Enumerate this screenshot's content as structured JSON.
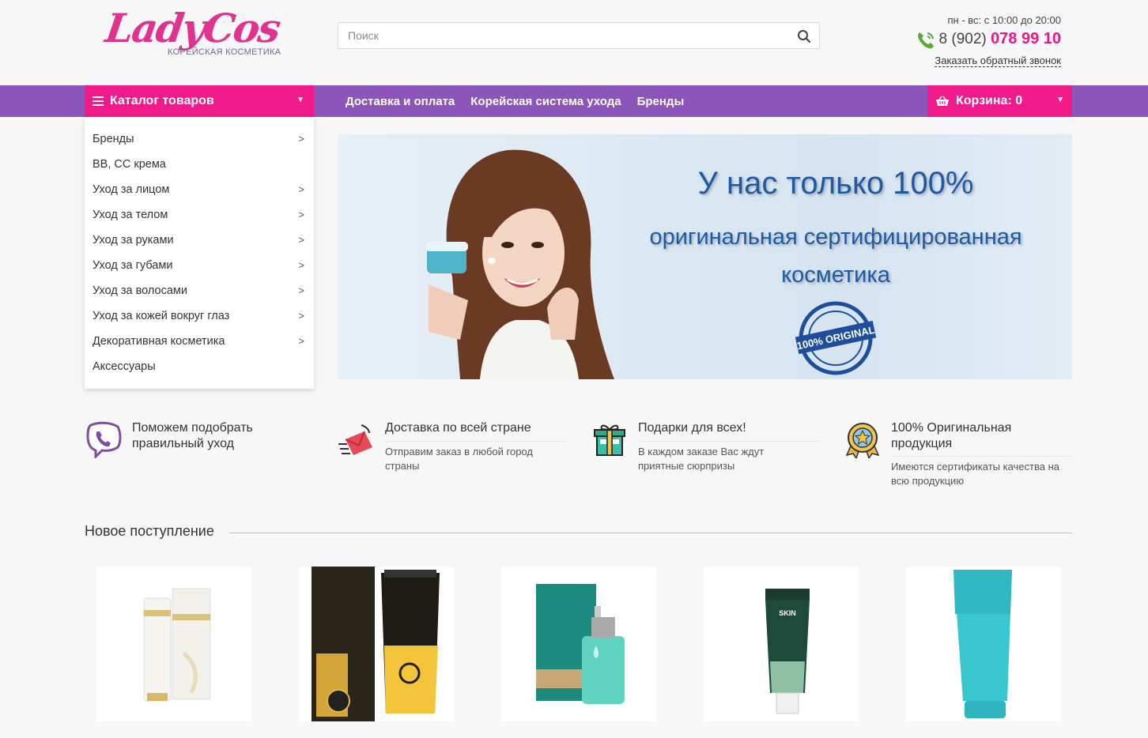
{
  "header": {
    "logo_text": "LadyCos",
    "logo_sub": "КОРЕЙСКАЯ КОСМЕТИКА",
    "search_placeholder": "Поиск",
    "hours": "пн - вс: с 10:00 до 20:00",
    "phone_prefix": "8 (902)",
    "phone_number": "078 99 10",
    "callback": "Заказать обратный звонок"
  },
  "nav": {
    "catalog": "Каталог товаров",
    "links": [
      "Доставка и оплата",
      "Корейская система ухода",
      "Бренды"
    ],
    "cart": "Корзина: 0"
  },
  "menu": [
    {
      "label": "Бренды",
      "has_sub": true
    },
    {
      "label": "BB, CC крема",
      "has_sub": false
    },
    {
      "label": "Уход за лицом",
      "has_sub": true
    },
    {
      "label": "Уход за телом",
      "has_sub": true
    },
    {
      "label": "Уход за руками",
      "has_sub": true
    },
    {
      "label": "Уход за губами",
      "has_sub": true
    },
    {
      "label": "Уход за волосами",
      "has_sub": true
    },
    {
      "label": "Уход за кожей вокруг глаз",
      "has_sub": true
    },
    {
      "label": "Декоративная косметика",
      "has_sub": true
    },
    {
      "label": "Аксессуары",
      "has_sub": false
    }
  ],
  "banner": {
    "line1": "У нас только 100%",
    "line2": "оригинальная сертифицированная",
    "line3": "косметика",
    "badge_text": "100% ORIGINAL"
  },
  "features": [
    {
      "icon": "viber-icon",
      "title": "Поможем подобрать правильный уход",
      "desc": ""
    },
    {
      "icon": "delivery-icon",
      "title": "Доставка по всей стране",
      "desc": "Отправим заказ в любой город страны"
    },
    {
      "icon": "gift-icon",
      "title": "Подарки для всех!",
      "desc": "В каждом заказе Вас ждут приятные сюрпризы"
    },
    {
      "icon": "medal-icon",
      "title": "100% Оригинальная продукция",
      "desc": "Имеются сертификаты качества на всю продукцию"
    }
  ],
  "new_arrivals": {
    "title": "Новое поступление",
    "products": [
      "retinol-cream-product",
      "escargot-cleansing-foam-product",
      "hyaluronic-ampoule-product",
      "im-sorry-skin-product",
      "hyaluronic-acid-gel-product"
    ]
  },
  "colors": {
    "brand_pink": "#f11a8a",
    "nav_purple": "#8b55b9",
    "banner_blue": "#1d5aa3"
  }
}
